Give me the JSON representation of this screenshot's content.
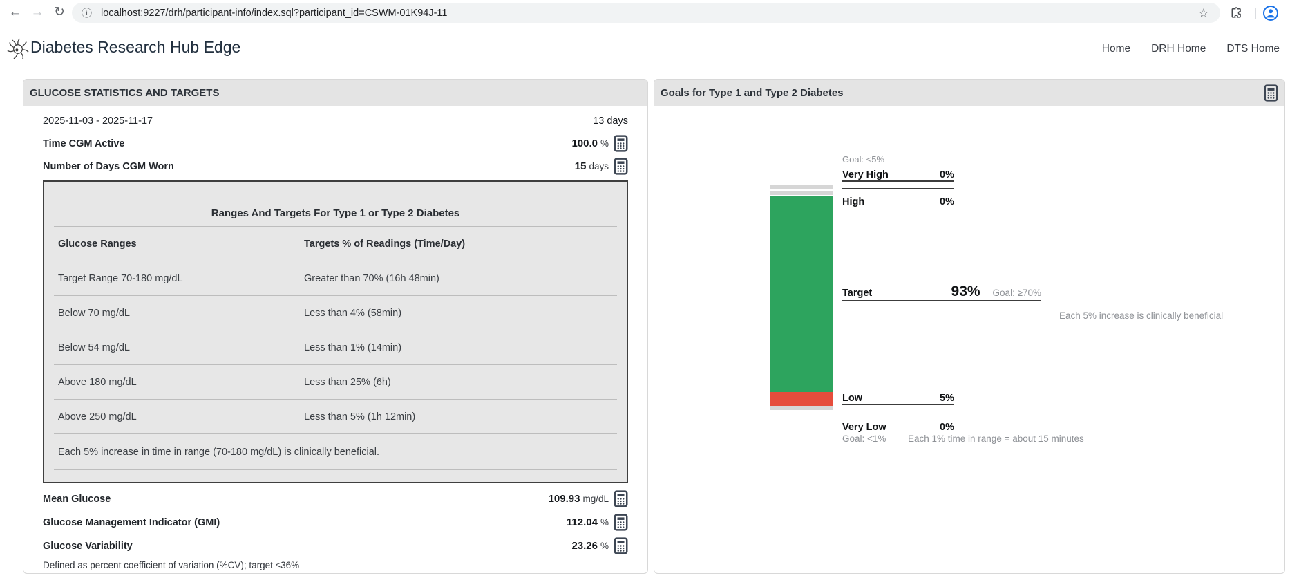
{
  "browser": {
    "url": "localhost:9227/drh/participant-info/index.sql?participant_id=CSWM-01K94J-11"
  },
  "header": {
    "title": "Diabetes Research Hub Edge",
    "nav": [
      {
        "label": "Home"
      },
      {
        "label": "DRH Home"
      },
      {
        "label": "DTS Home"
      }
    ]
  },
  "glucose_panel": {
    "title": "GLUCOSE STATISTICS AND TARGETS",
    "date_range": {
      "label": "2025-11-03 - 2025-11-17",
      "value": "13 days"
    },
    "metrics_top": [
      {
        "label": "Time CGM Active",
        "value": "100.0",
        "unit": "%"
      },
      {
        "label": "Number of Days CGM Worn",
        "value": "15",
        "unit": "days"
      }
    ],
    "table": {
      "title": "Ranges And Targets For Type 1 or Type 2 Diabetes",
      "columns": [
        "Glucose Ranges",
        "Targets % of Readings (Time/Day)"
      ],
      "rows": [
        [
          "Target Range 70-180 mg/dL",
          "Greater than 70% (16h 48min)"
        ],
        [
          "Below 70 mg/dL",
          "Less than 4% (58min)"
        ],
        [
          "Below 54 mg/dL",
          "Less than 1% (14min)"
        ],
        [
          "Above 180 mg/dL",
          "Less than 25% (6h)"
        ],
        [
          "Above 250 mg/dL",
          "Less than 5% (1h 12min)"
        ]
      ],
      "footer": "Each 5% increase in time in range (70-180 mg/dL) is clinically beneficial."
    },
    "metrics_bottom": [
      {
        "label": "Mean Glucose",
        "value": "109.93",
        "unit": "mg/dL"
      },
      {
        "label": "Glucose Management Indicator (GMI)",
        "value": "112.04",
        "unit": "%"
      },
      {
        "label": "Glucose Variability",
        "value": "23.26",
        "unit": "%"
      }
    ],
    "footnote": "Defined as percent coefficient of variation (%CV); target ≤36%"
  },
  "goals_panel": {
    "title": "Goals for Type 1 and Type 2 Diabetes",
    "chart_data": {
      "type": "stacked-bar",
      "orientation": "vertical",
      "ylim": [
        0,
        100
      ],
      "series": [
        {
          "name": "Very High",
          "value": 0,
          "display": "0%",
          "color": "#d6d6d6",
          "goal": "Goal: <5%"
        },
        {
          "name": "High",
          "value": 0,
          "display": "0%",
          "color": "#d6d6d6"
        },
        {
          "name": "Target",
          "value": 93,
          "display": "93%",
          "color": "#2da45e",
          "goal": "Goal: ≥70%",
          "note": "Each 5% increase is clinically beneficial"
        },
        {
          "name": "Low",
          "value": 5,
          "display": "5%",
          "color": "#e64d3c"
        },
        {
          "name": "Very Low",
          "value": 0,
          "display": "0%",
          "color": "#d6d6d6",
          "goal": "Goal: <1%",
          "note": "Each 1% time in range = about 15 minutes"
        }
      ]
    }
  }
}
